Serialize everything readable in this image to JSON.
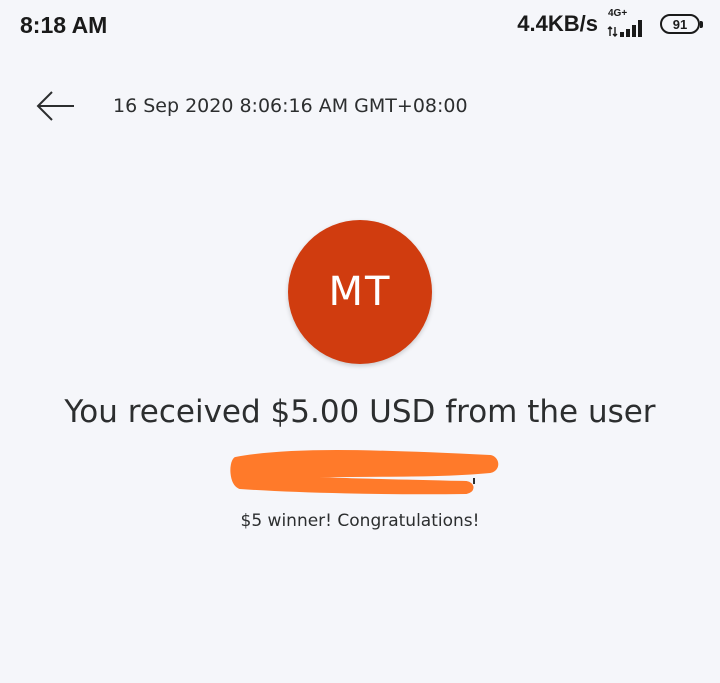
{
  "status_bar": {
    "time": "8:18 AM",
    "net_speed": "4.4KB/s",
    "net_type": "4G+",
    "battery": "91",
    "icons": [
      "signal-icon",
      "battery-icon"
    ]
  },
  "header": {
    "back_icon": "arrow-left-icon",
    "date": "16 Sep 2020 8:06:16 AM GMT+08:00"
  },
  "transaction": {
    "avatar_initials": "MT",
    "avatar_color": "#d03c0f",
    "headline": "You received $5.00 USD from the user",
    "note": "$5 winner! Congratulations!"
  },
  "colors": {
    "background": "#f5f6fa",
    "redaction": "#ff7a2a"
  }
}
